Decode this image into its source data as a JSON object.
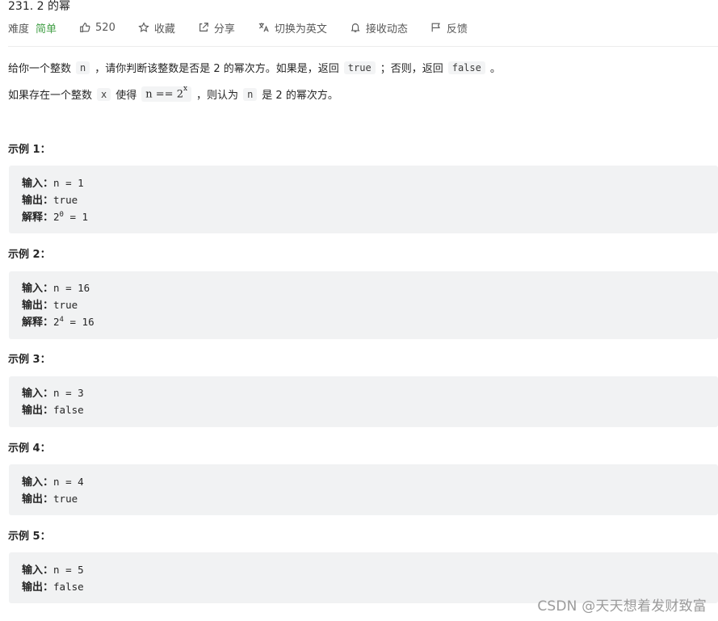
{
  "problem": {
    "title": "231. 2 的幂",
    "difficulty_label": "难度",
    "difficulty_value": "简单",
    "likes": "520",
    "favorite_label": "收藏",
    "share_label": "分享",
    "switch_lang_label": "切换为英文",
    "follow_label": "接收动态",
    "feedback_label": "反馈"
  },
  "description": {
    "p1_a": "给你一个整数",
    "p1_code_n": "n",
    "p1_b": "，请你判断该整数是否是 2 的幂次方。如果是，返回",
    "p1_code_true": "true",
    "p1_c": "；否则，返回",
    "p1_code_false": "false",
    "p1_d": "。",
    "p2_a": "如果存在一个整数",
    "p2_x": "x",
    "p2_b": "使得",
    "p2_math_base": "n == 2",
    "p2_math_exp": "x",
    "p2_c": "，则认为",
    "p2_n": "n",
    "p2_d": "是 2 的幂次方。"
  },
  "examples": [
    {
      "title": "示例 1：",
      "input_label": "输入：",
      "input_value": "n = 1",
      "output_label": "输出：",
      "output_value": "true",
      "explain_label": "解释：",
      "explain_base": "2",
      "explain_exp": "0",
      "explain_rest": " = 1"
    },
    {
      "title": "示例 2：",
      "input_label": "输入：",
      "input_value": "n = 16",
      "output_label": "输出：",
      "output_value": "true",
      "explain_label": "解释：",
      "explain_base": "2",
      "explain_exp": "4",
      "explain_rest": " = 16"
    },
    {
      "title": "示例 3：",
      "input_label": "输入：",
      "input_value": "n = 3",
      "output_label": "输出：",
      "output_value": "false"
    },
    {
      "title": "示例 4：",
      "input_label": "输入：",
      "input_value": "n = 4",
      "output_label": "输出：",
      "output_value": "true"
    },
    {
      "title": "示例 5：",
      "input_label": "输入：",
      "input_value": "n = 5",
      "output_label": "输出：",
      "output_value": "false"
    }
  ],
  "watermark": "CSDN @天天想着发财致富",
  "colors": {
    "easy": "#43a047",
    "code_bg": "#f3f4f5",
    "example_bg": "#f1f2f3"
  },
  "icons": [
    "thumbs-up-icon",
    "star-icon",
    "share-icon",
    "translate-icon",
    "bell-icon",
    "feedback-icon"
  ]
}
